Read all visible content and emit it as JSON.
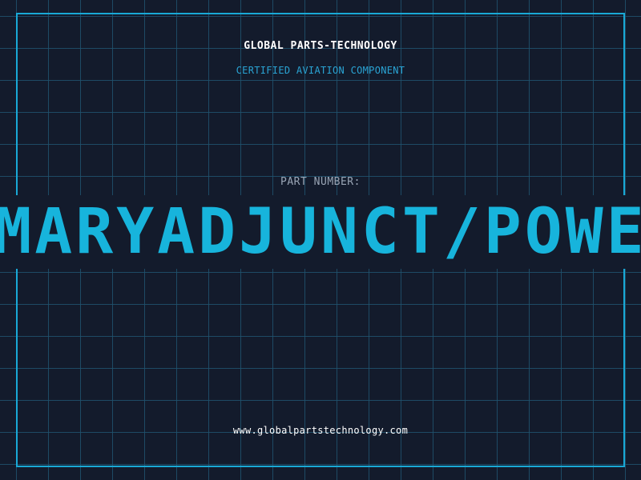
{
  "header": {
    "company": "GLOBAL PARTS-TECHNOLOGY",
    "subtitle": "CERTIFIED AVIATION COMPONENT"
  },
  "part": {
    "label": "PART NUMBER:",
    "number": "PRIMARYADJUNCT/POWERDR"
  },
  "footer": {
    "website": "www.globalpartstechnology.com"
  },
  "colors": {
    "background": "#131b2c",
    "grid": "#1f526e",
    "accent": "#17b4dc",
    "label": "#9aa6b6",
    "text": "#ffffff"
  }
}
